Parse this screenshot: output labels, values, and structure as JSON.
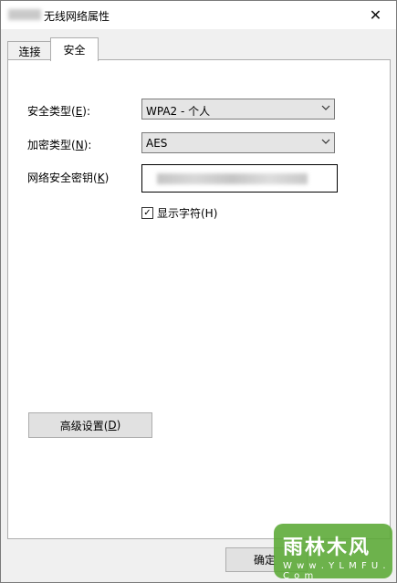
{
  "window": {
    "title": "无线网络属性"
  },
  "tabs": [
    {
      "label": "连接",
      "active": false
    },
    {
      "label": "安全",
      "active": true
    }
  ],
  "security": {
    "type_label_prefix": "安全类型(",
    "type_label_mnemonic": "E",
    "type_label_suffix": "):",
    "type_value": "WPA2 - 个人",
    "enc_label_prefix": "加密类型(",
    "enc_label_mnemonic": "N",
    "enc_label_suffix": "):",
    "enc_value": "AES",
    "key_label_prefix": "网络安全密钥(",
    "key_label_mnemonic": "K",
    "key_label_suffix": ")",
    "show_chars_label": "显示字符(H)",
    "show_chars_checked": true
  },
  "buttons": {
    "advanced_prefix": "高级设置(",
    "advanced_mnemonic": "D",
    "advanced_suffix": ")",
    "ok": "确定"
  },
  "watermark": {
    "text": "雨林木风",
    "sub": "W w w . Y L M F U . C o m"
  },
  "icons": {
    "close": "close-icon",
    "dropdown": "chevron-down-icon",
    "check": "checkmark-icon"
  }
}
